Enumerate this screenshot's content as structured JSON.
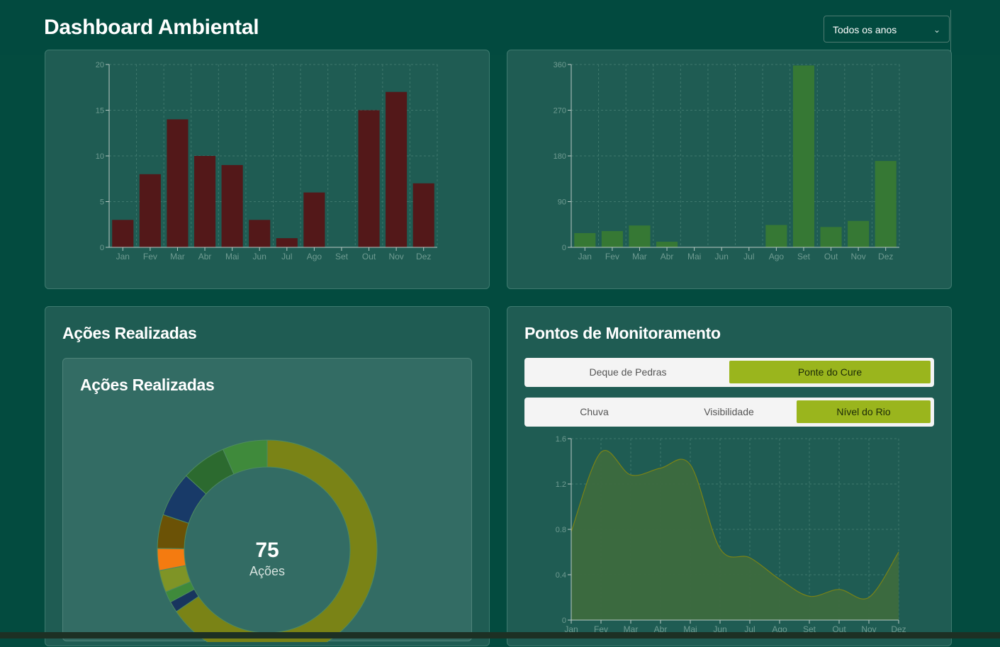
{
  "header": {
    "title": "Dashboard Ambiental",
    "year_select": "Todos os anos"
  },
  "months": [
    "Jan",
    "Fev",
    "Mar",
    "Abr",
    "Mai",
    "Jun",
    "Jul",
    "Ago",
    "Set",
    "Out",
    "Nov",
    "Dez"
  ],
  "chart_data": [
    {
      "type": "bar",
      "categories": [
        "Jan",
        "Fev",
        "Mar",
        "Abr",
        "Mai",
        "Jun",
        "Jul",
        "Ago",
        "Set",
        "Out",
        "Nov",
        "Dez"
      ],
      "values": [
        3,
        8,
        14,
        10,
        9,
        3,
        1,
        6,
        0,
        15,
        17,
        7
      ],
      "ylim": [
        0,
        20
      ],
      "yticks": [
        0,
        5,
        10,
        15,
        20
      ],
      "color": "#531819",
      "grid": true
    },
    {
      "type": "bar",
      "categories": [
        "Jan",
        "Fev",
        "Mar",
        "Abr",
        "Mai",
        "Jun",
        "Jul",
        "Ago",
        "Set",
        "Out",
        "Nov",
        "Dez"
      ],
      "values": [
        28,
        32,
        43,
        11,
        0,
        0,
        0,
        44,
        358,
        40,
        52,
        170
      ],
      "ylim": [
        0,
        360
      ],
      "yticks": [
        0,
        90,
        180,
        270,
        360
      ],
      "color": "#367834",
      "grid": true
    },
    {
      "type": "pie",
      "title": "Ações Realizadas",
      "total": "75",
      "total_label": "Ações",
      "slices": [
        {
          "value": 52.6,
          "color": "#7a8316"
        },
        {
          "value": 1.3,
          "color": "#18355e"
        },
        {
          "value": 1.3,
          "color": "#3f8a3b"
        },
        {
          "value": 2.6,
          "color": "#7f9426"
        },
        {
          "value": 2.6,
          "color": "#f47b10"
        },
        {
          "value": 4.0,
          "color": "#6b5206"
        },
        {
          "value": 5.3,
          "color": "#183a68"
        },
        {
          "value": 5.3,
          "color": "#2c6a2f"
        },
        {
          "value": 5.3,
          "color": "#3f8a3b"
        }
      ]
    },
    {
      "type": "area",
      "x": [
        "Jan",
        "Fev",
        "Mar",
        "Abr",
        "Mai",
        "Jun",
        "Jul",
        "Ago",
        "Set",
        "Out",
        "Nov",
        "Dez"
      ],
      "y": [
        0.78,
        1.48,
        1.28,
        1.34,
        1.37,
        0.63,
        0.55,
        0.36,
        0.21,
        0.27,
        0.2,
        0.6
      ],
      "ylim": [
        0,
        1.6
      ],
      "yticks": [
        0,
        0.4,
        0.8,
        1.2,
        1.6
      ],
      "color": "#7a8316",
      "grid": true
    }
  ],
  "actions_card": {
    "title": "Ações Realizadas",
    "inner_title": "Ações Realizadas"
  },
  "monitoring_card": {
    "title": "Pontos de Monitoramento",
    "locations": [
      "Deque de Pedras",
      "Ponte do Cure"
    ],
    "active_location": "Ponte do Cure",
    "metrics": [
      "Chuva",
      "Visibilidade",
      "Nível do Rio"
    ],
    "active_metric": "Nível do Rio"
  }
}
